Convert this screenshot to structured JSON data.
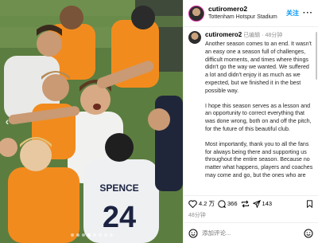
{
  "header": {
    "username": "cutiromero2",
    "location": "Tottenham Hotspur Stadium",
    "follow_label": "关注",
    "more_label": "···"
  },
  "caption": {
    "username": "cutiromero2",
    "edited": "已编辑",
    "time": "48分钟",
    "paragraphs": [
      "Another season comes to an end. It wasn't an easy one a season full of challenges, difficult moments, and times where things didn't go the way we wanted. We suffered a lot and didn't enjoy it as much as we expected, but we finished it in the best possible way.",
      "I hope this season serves as a lesson and an opportunity to correct everything that was done wrong, both on and off the pitch, for the future of this beautiful club.",
      "Most importantly, thank you to all the fans for always being there and supporting us throughout the entire season. Because no matter what happens, players and coaches may come and go, but the ones who are"
    ]
  },
  "actions": {
    "likes": "4.2 万",
    "comments": "366",
    "shares": "143"
  },
  "date_label": "48分钟",
  "comment_placeholder": "添加评论...",
  "photo": {
    "jersey_name": "SPENCE",
    "jersey_number": "24",
    "carousel_dots": 8,
    "active_dot": 3
  },
  "colors": {
    "accent": "#0095f6",
    "bib_orange": "#f28b1e",
    "pitch_green": "#5c7d40"
  }
}
